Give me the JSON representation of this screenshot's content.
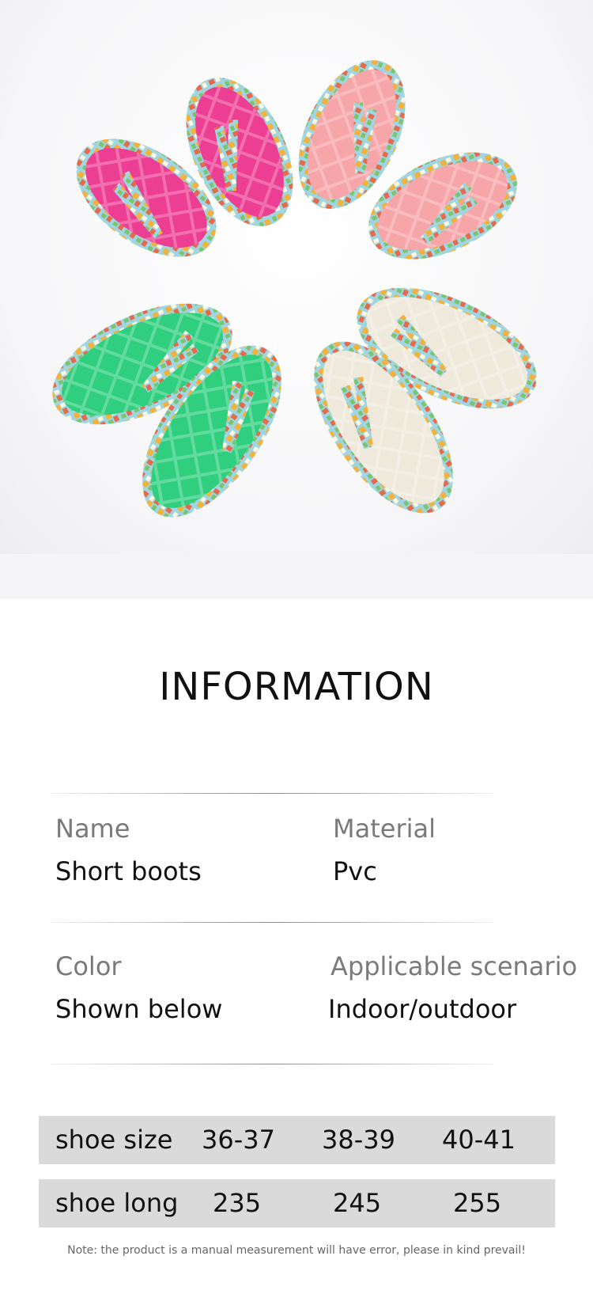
{
  "product_image": {
    "description_icon": "flip-flop-sandals-photo",
    "colors": {
      "rose": "#ec3f94",
      "pink": "#f6a5a8",
      "green": "#2fcf7f",
      "cream": "#efe9dc"
    }
  },
  "info": {
    "title": "INFORMATION",
    "name_label": "Name",
    "name_value": "Short boots",
    "material_label": "Material",
    "material_value": "Pvc",
    "color_label": "Color",
    "color_value": "Shown below",
    "scenario_label": "Applicable scenario",
    "scenario_value": "Indoor/outdoor"
  },
  "size_table": {
    "rows": [
      {
        "label": "shoe size",
        "values": [
          "36-37",
          "38-39",
          "40-41"
        ]
      },
      {
        "label": "shoe long",
        "values": [
          "235",
          "245",
          "255"
        ]
      }
    ]
  },
  "note": "Note: the product is a manual measurement will have error, please in kind prevail!"
}
